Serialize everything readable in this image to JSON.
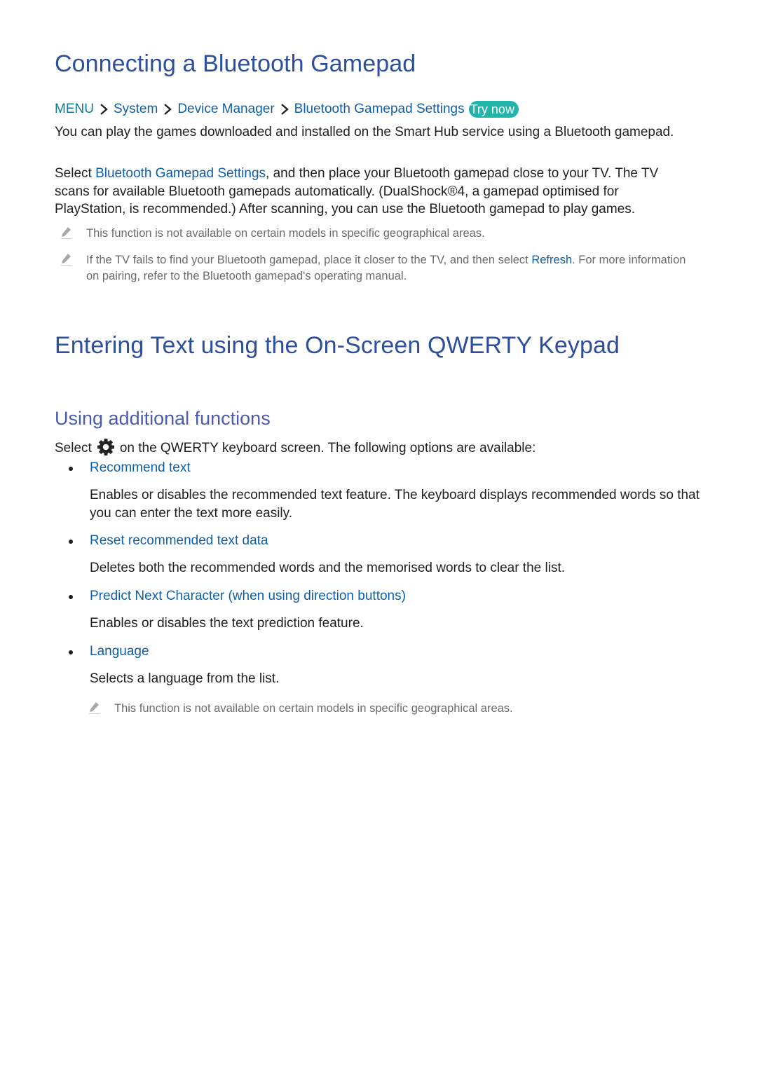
{
  "section1": {
    "title": "Connecting a Bluetooth Gamepad",
    "breadcrumb": {
      "menu": "MENU",
      "items": [
        "System",
        "Device Manager",
        "Bluetooth Gamepad Settings"
      ],
      "try_now": "Try now"
    },
    "para1": "You can play the games downloaded and installed on the Smart Hub service using a Bluetooth gamepad.",
    "para2": {
      "prefix": "Select ",
      "link": "Bluetooth Gamepad Settings",
      "suffix": ", and then place your Bluetooth gamepad close to your TV. The TV scans for available Bluetooth gamepads automatically. (DualShock®4, a gamepad optimised for PlayStation, is recommended.) After scanning, you can use the Bluetooth gamepad to play games."
    },
    "notes": [
      {
        "text": "This function is not available on certain models in specific geographical areas."
      },
      {
        "prefix": "If the TV fails to find your Bluetooth gamepad, place it closer to the TV, and then select ",
        "link": "Refresh",
        "suffix": ". For more information on pairing, refer to the Bluetooth gamepad's operating manual."
      }
    ]
  },
  "section2": {
    "title": "Entering Text using the On-Screen QWERTY Keypad",
    "subtitle": "Using additional functions",
    "select_prefix": "Select",
    "select_suffix": "on the QWERTY keyboard screen. The following options are available:",
    "gear_icon": "settings-gear-icon",
    "options": [
      {
        "label": "Recommend text",
        "desc": "Enables or disables the recommended text feature. The keyboard displays recommended words so that you can enter the text more easily."
      },
      {
        "label": "Reset recommended text data",
        "desc": "Deletes both the recommended words and the memorised words to clear the list."
      },
      {
        "label": "Predict Next Character (when using direction buttons)",
        "desc": "Enables or disables the text prediction feature."
      },
      {
        "label": "Language",
        "desc": "Selects a language from the list."
      }
    ],
    "note": "This function is not available on certain models in specific geographical areas."
  },
  "colors": {
    "heading": "#2e4e9e",
    "subheading": "#4a5cb0",
    "link": "#0f5fa8",
    "menu": "#0f7b95",
    "try_now_bg": "#22b3a9",
    "note_text": "#6b6b6b"
  }
}
